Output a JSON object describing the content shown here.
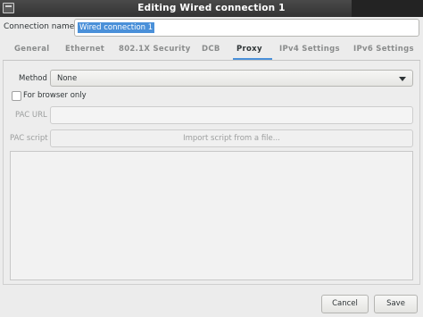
{
  "window": {
    "title": "Editing Wired connection 1",
    "icon": "app-window-icon"
  },
  "connection": {
    "label": "Connection name",
    "value": "Wired connection 1"
  },
  "tabs": [
    {
      "label": "General",
      "active": false
    },
    {
      "label": "Ethernet",
      "active": false
    },
    {
      "label": "802.1X Security",
      "active": false
    },
    {
      "label": "DCB",
      "active": false
    },
    {
      "label": "Proxy",
      "active": true
    },
    {
      "label": "IPv4 Settings",
      "active": false
    },
    {
      "label": "IPv6 Settings",
      "active": false
    }
  ],
  "proxy": {
    "method_label": "Method",
    "method_value": "None",
    "browser_only_label": "For browser only",
    "browser_only_checked": false,
    "pac_url_label": "PAC URL",
    "pac_url_value": "",
    "pac_script_label": "PAC script",
    "import_button_label": "Import script from a file...",
    "script_text": ""
  },
  "buttons": {
    "cancel": "Cancel",
    "save": "Save"
  },
  "colors": {
    "accent": "#4a90d9",
    "titlebar": "#3c3c3c",
    "background": "#ececec"
  }
}
